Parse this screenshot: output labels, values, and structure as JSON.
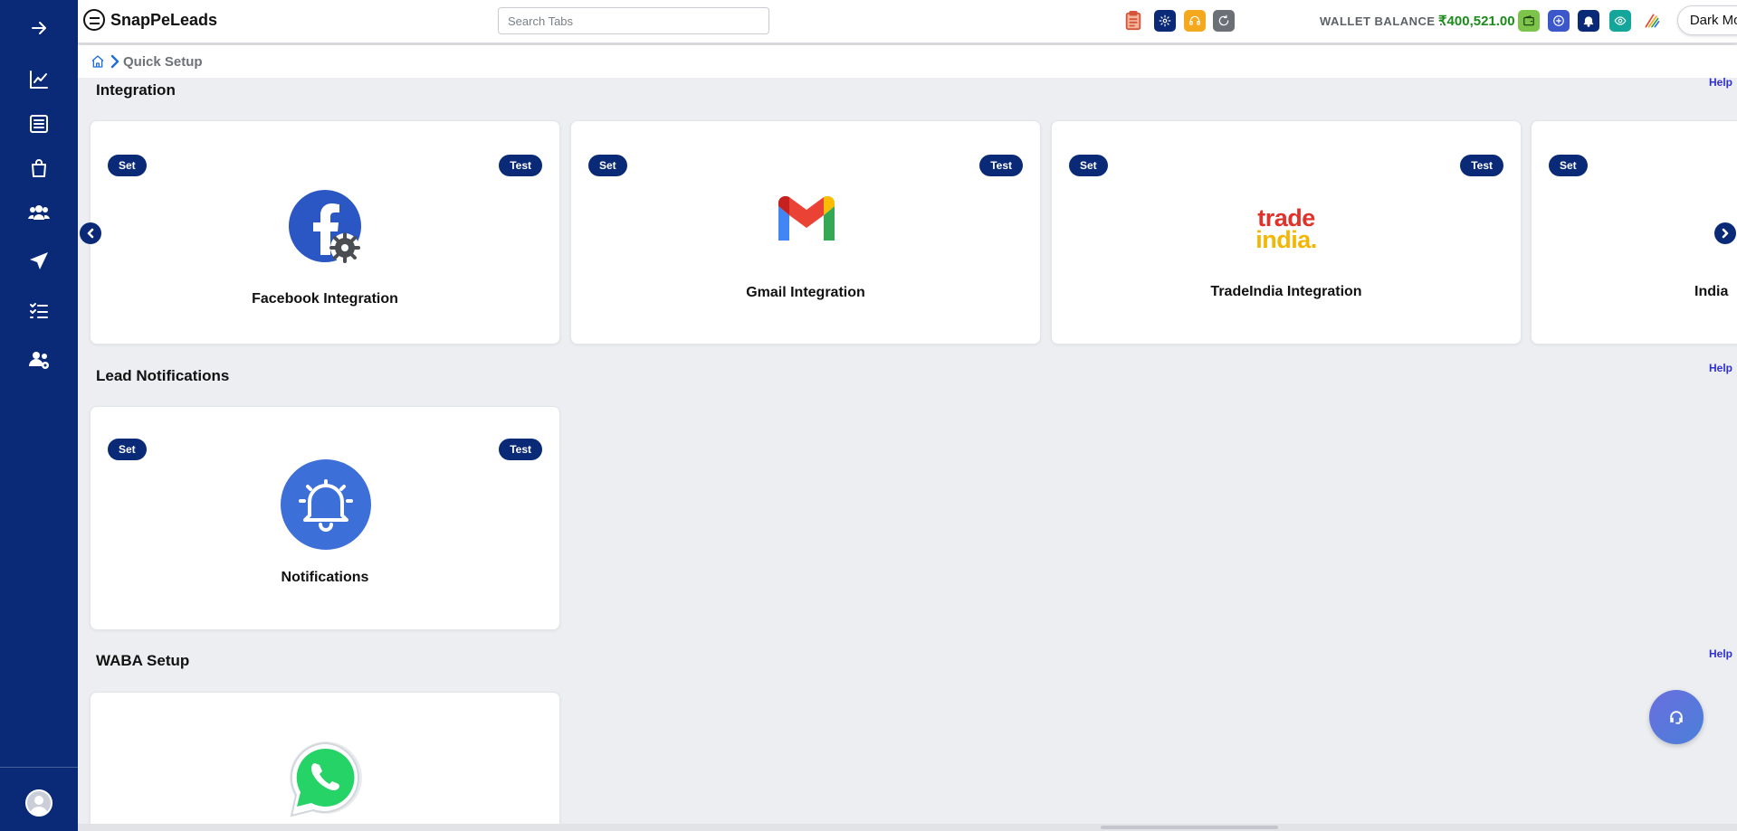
{
  "app": {
    "name": "SnapPeLeads"
  },
  "search": {
    "placeholder": "Search Tabs"
  },
  "topbar": {
    "wallet_label": "WALLET BALANCE :",
    "wallet_value": "₹400,521.00",
    "dark_mode_label": "Dark Mode",
    "icons": [
      "clipboard-icon",
      "settings-icon",
      "support-icon",
      "refresh-icon",
      "wallet-icon",
      "add-icon",
      "notification-bell-icon",
      "eye-icon",
      "brand-icon",
      "logout-icon"
    ]
  },
  "sidebar": {
    "items": [
      "expand-arrow-icon",
      "analytics-chart-icon",
      "list-icon",
      "shopping-bag-icon",
      "users-icon",
      "send-icon",
      "task-list-icon",
      "team-settings-icon"
    ]
  },
  "breadcrumb": {
    "current": "Quick Setup"
  },
  "sections": {
    "integration": {
      "title": "Integration",
      "help": "Help",
      "cards": [
        {
          "label": "Facebook Integration",
          "set": "Set",
          "test": "Test"
        },
        {
          "label": "Gmail Integration",
          "set": "Set",
          "test": "Test"
        },
        {
          "label": "TradeIndia Integration",
          "set": "Set",
          "test": "Test",
          "logo_top": "trade",
          "logo_bottom": "india."
        },
        {
          "label": "India",
          "set": "Set"
        }
      ]
    },
    "lead_notifications": {
      "title": "Lead Notifications",
      "help": "Help",
      "cards": [
        {
          "label": "Notifications",
          "set": "Set",
          "test": "Test"
        }
      ]
    },
    "waba": {
      "title": "WABA Setup",
      "help": "Help"
    }
  },
  "colors": {
    "sidebar": "#0a2a78",
    "accent": "#0a2a78",
    "wallet": "#1a8c1a",
    "help": "#2f2fd8",
    "logout": "#e5202e"
  }
}
